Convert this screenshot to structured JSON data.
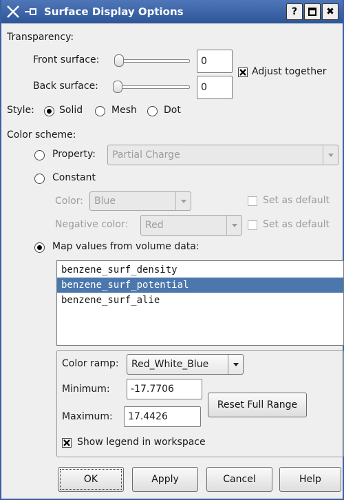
{
  "window": {
    "title": "Surface Display Options",
    "controls": {
      "help": "?",
      "maximize": "",
      "close": "✖"
    }
  },
  "transparency": {
    "heading": "Transparency:",
    "front_label": "Front surface:",
    "front_value": "0",
    "front_slider_fraction": 0,
    "back_label": "Back surface:",
    "back_value": "0",
    "back_slider_fraction": 0,
    "adjust_together_label": "Adjust together",
    "adjust_together_checked": true
  },
  "style": {
    "label": "Style:",
    "options": [
      "Solid",
      "Mesh",
      "Dot"
    ],
    "selected": "Solid"
  },
  "color_scheme": {
    "heading": "Color scheme:",
    "property_label": "Property:",
    "property_value": "Partial Charge",
    "constant_label": "Constant",
    "color_label": "Color:",
    "color_value": "Blue",
    "set_default_label": "Set as default",
    "negative_color_label": "Negative color:",
    "negative_color_value": "Red",
    "set_default_label_2": "Set as default",
    "map_label": "Map values from volume data:",
    "selected_option": "map"
  },
  "volume_list": {
    "items": [
      "benzene_surf_density",
      "benzene_surf_potential",
      "benzene_surf_alie"
    ],
    "selected_index": 1
  },
  "ramp": {
    "color_ramp_label": "Color ramp:",
    "color_ramp_value": "Red_White_Blue",
    "minimum_label": "Minimum:",
    "minimum_value": "-17.7706",
    "maximum_label": "Maximum:",
    "maximum_value": "17.4426",
    "reset_label": "Reset Full Range",
    "show_legend_label": "Show legend in workspace",
    "show_legend_checked": true
  },
  "buttons": {
    "ok": "OK",
    "apply": "Apply",
    "cancel": "Cancel",
    "help": "Help"
  },
  "colors": {
    "title_bar": "#3f67a8",
    "selection": "#4c77ad"
  }
}
